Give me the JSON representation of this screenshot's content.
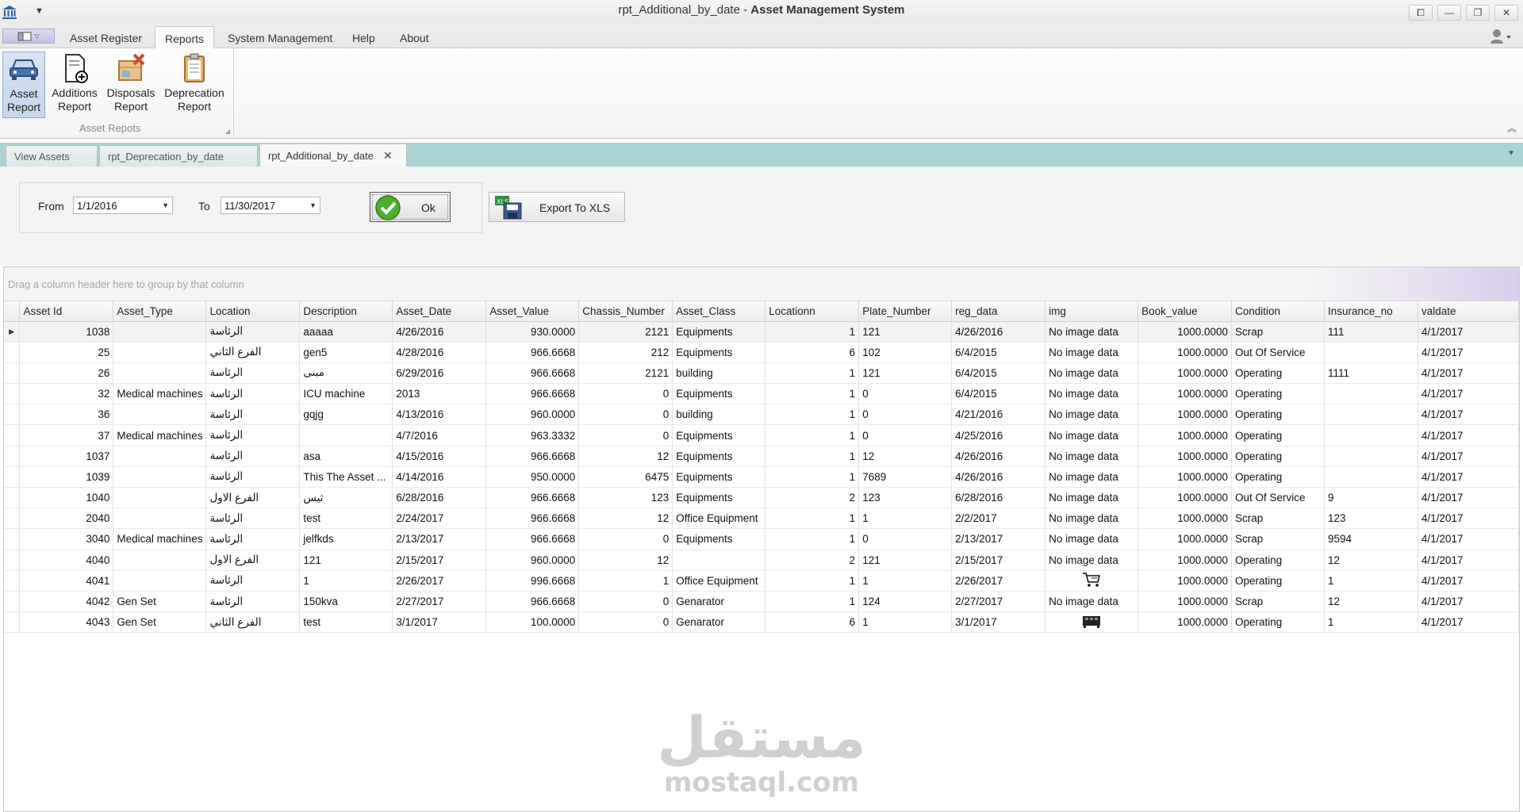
{
  "window": {
    "title_doc": "rpt_Additional_by_date",
    "title_sep": " - ",
    "title_app": "Asset Management System",
    "controls": [
      "⧠",
      "—",
      "❐",
      "✕"
    ]
  },
  "menu": {
    "tabs": [
      "Asset Register",
      "Reports",
      "System Management",
      "Help",
      "About"
    ],
    "active": "Reports"
  },
  "ribbon": {
    "buttons": [
      {
        "line1": "Asset",
        "line2": "Report",
        "icon": "car-icon"
      },
      {
        "line1": "Additions",
        "line2": "Report",
        "icon": "document-add-icon"
      },
      {
        "line1": "Disposals",
        "line2": "Report",
        "icon": "disposal-box-icon"
      },
      {
        "line1": "Deprecation",
        "line2": "Report",
        "icon": "clipboard-icon"
      }
    ],
    "group_label": "Asset Repots"
  },
  "doc_tabs": [
    "View Assets",
    "rpt_Deprecation_by_date",
    "rpt_Additional_by_date"
  ],
  "filter": {
    "from_label": "From",
    "from_value": "1/1/2016",
    "to_label": "To",
    "to_value": "11/30/2017",
    "ok_label": "Ok",
    "export_label": "Export To XLS"
  },
  "grid": {
    "group_hint": "Drag a column header here to group by that column",
    "columns": [
      "Asset Id",
      "Asset_Type",
      "Location",
      "Description",
      "Asset_Date",
      "Asset_Value",
      "Chassis_Number",
      "Asset_Class",
      "Locationn",
      "Plate_Number",
      "reg_data",
      "img",
      "Book_value",
      "Condition",
      "Insurance_no",
      "valdate"
    ],
    "rows": [
      [
        "1038",
        "",
        "الرئاسة",
        "aaaaa",
        "4/26/2016",
        "930.0000",
        "2121",
        "Equipments",
        "1",
        "121",
        "4/26/2016",
        "No image data",
        "1000.0000",
        "Scrap",
        "111",
        "4/1/2017"
      ],
      [
        "25",
        "",
        "الفرع الثاني",
        "gen5",
        "4/28/2016",
        "966.6668",
        "212",
        "Equipments",
        "6",
        "102",
        "6/4/2015",
        "No image data",
        "1000.0000",
        "Out Of Service",
        "",
        "4/1/2017"
      ],
      [
        "26",
        "",
        "الرئاسة",
        "مبنى",
        "6/29/2016",
        "966.6668",
        "2121",
        "building",
        "1",
        "121",
        "6/4/2015",
        "No image data",
        "1000.0000",
        "Operating",
        "1111",
        "4/1/2017"
      ],
      [
        "32",
        "Medical machines",
        "الرئاسة",
        "ICU machine",
        "2013",
        "966.6668",
        "0",
        "Equipments",
        "1",
        "0",
        "6/4/2015",
        "No image data",
        "1000.0000",
        "Operating",
        "",
        "4/1/2017"
      ],
      [
        "36",
        "",
        "الرئاسة",
        "gqjg",
        "4/13/2016",
        "960.0000",
        "0",
        "building",
        "1",
        "0",
        "4/21/2016",
        "No image data",
        "1000.0000",
        "Operating",
        "",
        "4/1/2017"
      ],
      [
        "37",
        "Medical machines",
        "الرئاسة",
        "",
        "4/7/2016",
        "963.3332",
        "0",
        "Equipments",
        "1",
        "0",
        "4/25/2016",
        "No image data",
        "1000.0000",
        "Operating",
        "",
        "4/1/2017"
      ],
      [
        "1037",
        "",
        "الرئاسة",
        "asa",
        "4/15/2016",
        "966.6668",
        "12",
        "Equipments",
        "1",
        "12",
        "4/26/2016",
        "No image data",
        "1000.0000",
        "Operating",
        "",
        "4/1/2017"
      ],
      [
        "1039",
        "",
        "الرئاسة",
        "This The Asset ...",
        "4/14/2016",
        "950.0000",
        "6475",
        "Equipments",
        "1",
        "7689",
        "4/26/2016",
        "No image data",
        "1000.0000",
        "Operating",
        "",
        "4/1/2017"
      ],
      [
        "1040",
        "",
        "الفرع الاول",
        "ثيس",
        "6/28/2016",
        "966.6668",
        "123",
        "Equipments",
        "2",
        "123",
        "6/28/2016",
        "No image data",
        "1000.0000",
        "Out Of Service",
        "9",
        "4/1/2017"
      ],
      [
        "2040",
        "",
        "الرئاسة",
        "test",
        "2/24/2017",
        "966.6668",
        "12",
        "Office Equipment",
        "1",
        "1",
        "2/2/2017",
        "No image data",
        "1000.0000",
        "Scrap",
        "123",
        "4/1/2017"
      ],
      [
        "3040",
        "Medical machines",
        "الرئاسة",
        "jelfkds",
        "2/13/2017",
        "966.6668",
        "0",
        "Equipments",
        "1",
        "0",
        "2/13/2017",
        "No image data",
        "1000.0000",
        "Scrap",
        "9594",
        "4/1/2017"
      ],
      [
        "4040",
        "",
        "الفرع الاول",
        "121",
        "2/15/2017",
        "960.0000",
        "12",
        "",
        "2",
        "121",
        "2/15/2017",
        "No image data",
        "1000.0000",
        "Operating",
        "12",
        "4/1/2017"
      ],
      [
        "4041",
        "",
        "الرئاسة",
        "1",
        "2/26/2017",
        "996.6668",
        "1",
        "Office Equipment",
        "1",
        "1",
        "2/26/2017",
        "",
        "1000.0000",
        "Operating",
        "1",
        "4/1/2017"
      ],
      [
        "4042",
        "Gen Set",
        "الرئاسة",
        "150kva",
        "2/27/2017",
        "966.6668",
        "0",
        "Genarator",
        "1",
        "124",
        "2/27/2017",
        "No image data",
        "1000.0000",
        "Scrap",
        "12",
        "4/1/2017"
      ],
      [
        "4043",
        "Gen Set",
        "الفرع الثاني",
        "test",
        "3/1/2017",
        "100.0000",
        "0",
        "Genarator",
        "6",
        "1",
        "3/1/2017",
        "",
        "1000.0000",
        "Operating",
        "1",
        "4/1/2017"
      ]
    ],
    "row_images": {
      "12": "cart-icon",
      "14": "generator-icon"
    },
    "selected_row": 0
  },
  "watermark": {
    "arabic": "مستقل",
    "latin": "mostaql.com"
  }
}
